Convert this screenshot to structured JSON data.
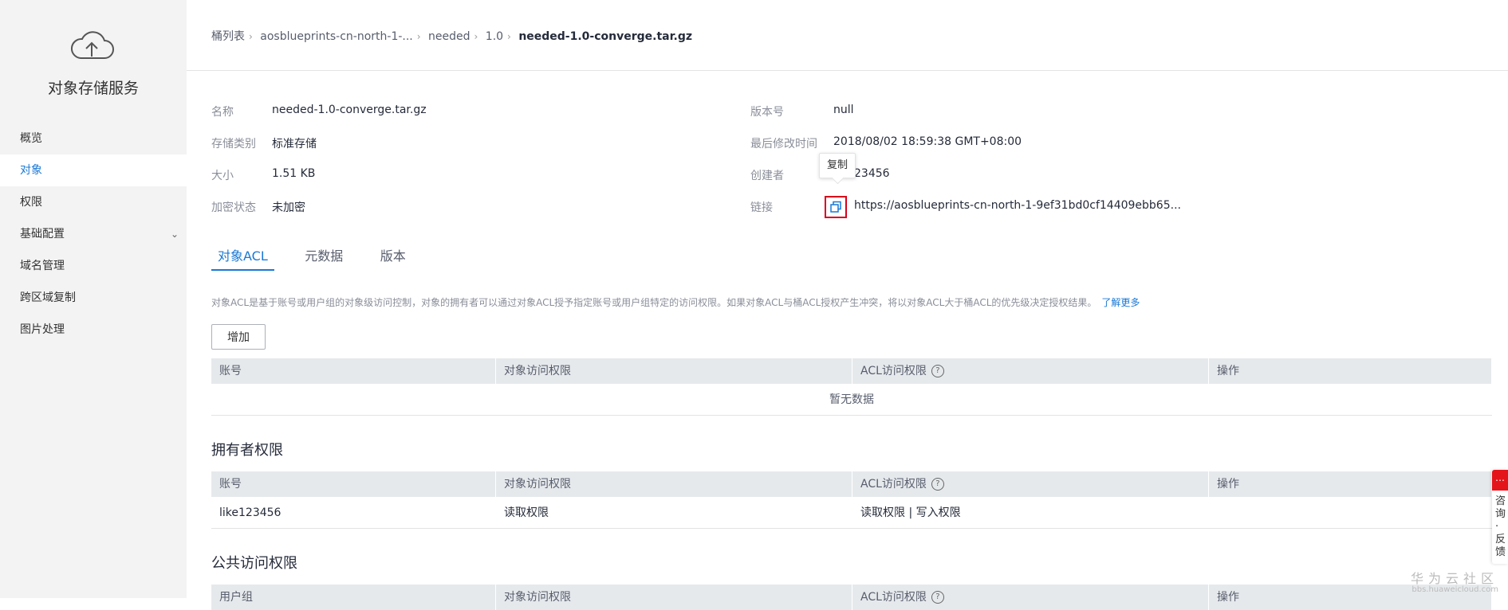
{
  "sidebar": {
    "service_title": "对象存储服务",
    "items": [
      {
        "label": "概览"
      },
      {
        "label": "对象"
      },
      {
        "label": "权限"
      },
      {
        "label": "基础配置"
      },
      {
        "label": "域名管理"
      },
      {
        "label": "跨区域复制"
      },
      {
        "label": "图片处理"
      }
    ],
    "active_index": 1
  },
  "breadcrumb": [
    "桶列表",
    "aosblueprints-cn-north-1-...",
    "needed",
    "1.0",
    "needed-1.0-converge.tar.gz"
  ],
  "info": {
    "name_label": "名称",
    "name_value": "needed-1.0-converge.tar.gz",
    "storage_label": "存储类别",
    "storage_value": "标准存储",
    "size_label": "大小",
    "size_value": "1.51 KB",
    "encrypt_label": "加密状态",
    "encrypt_value": "未加密",
    "version_label": "版本号",
    "version_value": "null",
    "modified_label": "最后修改时间",
    "modified_value": "2018/08/02 18:59:38 GMT+08:00",
    "creator_label": "创建者",
    "creator_value": "23456",
    "link_label": "链接",
    "link_value": "https://aosblueprints-cn-north-1-9ef31bd0cf14409ebb65..."
  },
  "tooltip": "复制",
  "tabs": [
    "对象ACL",
    "元数据",
    "版本"
  ],
  "acl": {
    "description": "对象ACL是基于账号或用户组的对象级访问控制，对象的拥有者可以通过对象ACL授予指定账号或用户组特定的访问权限。如果对象ACL与桶ACL授权产生冲突，将以对象ACL大于桶ACL的优先级决定授权结果。",
    "learn_more": "了解更多",
    "add_label": "增加",
    "columns": [
      "账号",
      "对象访问权限",
      "ACL访问权限",
      "操作"
    ],
    "empty_text": "暂无数据"
  },
  "owner": {
    "title": "拥有者权限",
    "columns": [
      "账号",
      "对象访问权限",
      "ACL访问权限",
      "操作"
    ],
    "row": {
      "account": "like123456",
      "object_access": "读取权限",
      "acl_access": "读取权限 | 写入权限"
    }
  },
  "public": {
    "title": "公共访问权限",
    "columns": [
      "用户组",
      "对象访问权限",
      "ACL访问权限",
      "操作"
    ]
  },
  "float_tab": {
    "text": "咨询·反馈"
  },
  "watermark": {
    "line1": "华为云社区",
    "line2": "bbs.huaweicloud.com"
  },
  "colors": {
    "accent": "#1a78d6",
    "highlight": "#d9001b",
    "sidebar_bg": "#f3f3f3"
  }
}
